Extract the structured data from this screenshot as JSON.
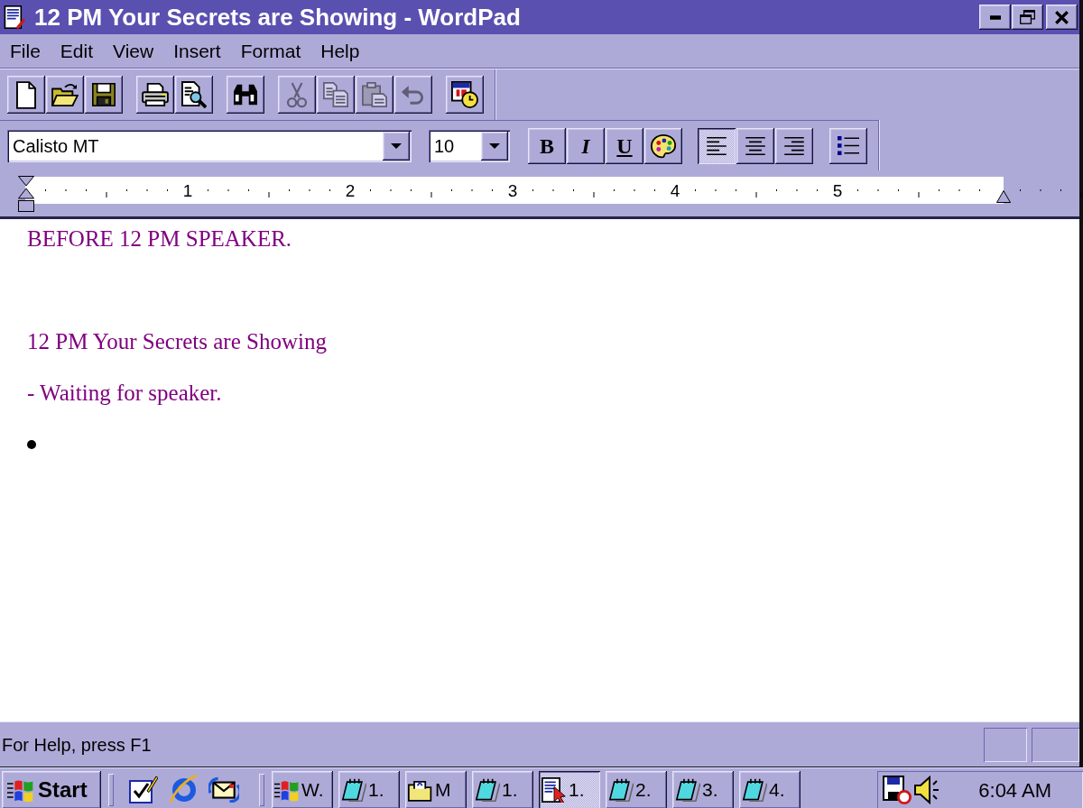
{
  "window": {
    "title": "12 PM Your Secrets are Showing - WordPad"
  },
  "menu_bar": [
    "File",
    "Edit",
    "View",
    "Insert",
    "Format",
    "Help"
  ],
  "toolbar": {
    "groups": [
      [
        {
          "disabled": false
        },
        {
          "disabled": false
        },
        {
          "disabled": false
        }
      ],
      [
        {
          "disabled": false
        },
        {
          "disabled": false
        }
      ],
      [
        {
          "disabled": false
        }
      ],
      [
        {
          "disabled": true
        },
        {
          "disabled": true
        },
        {
          "disabled": true
        },
        {
          "disabled": true
        }
      ],
      [
        {
          "disabled": false
        }
      ]
    ]
  },
  "format_bar": {
    "font": {
      "value": "Calisto MT"
    },
    "size": {
      "value": "10"
    },
    "styles": [
      {
        "label": "B",
        "on": false
      },
      {
        "label": "I",
        "on": false
      },
      {
        "label": "U",
        "on": false
      }
    ],
    "alignment": [
      {
        "selected": true
      },
      {
        "selected": false
      },
      {
        "selected": false
      }
    ],
    "bullets": {
      "on": false
    }
  },
  "ruler": {
    "labels": [
      "1",
      "2",
      "3",
      "4",
      "5"
    ]
  },
  "document": {
    "paragraphs": [
      {
        "kind": "text",
        "text": "BEFORE 12 PM SPEAKER."
      },
      {
        "kind": "blank"
      },
      {
        "kind": "text",
        "text": "12 PM Your Secrets are Showing"
      },
      {
        "kind": "text",
        "text": "- Waiting for speaker."
      },
      {
        "kind": "bullet"
      }
    ]
  },
  "status_bar": {
    "text": "For Help, press F1"
  },
  "taskbar": {
    "start": {
      "label": "Start"
    },
    "tasks": [
      {
        "label": "W.",
        "selected": false
      },
      {
        "label": "1.",
        "selected": false
      },
      {
        "label": "M",
        "selected": false
      },
      {
        "label": "1.",
        "selected": false
      },
      {
        "label": "1.",
        "selected": true
      },
      {
        "label": "2.",
        "selected": false
      },
      {
        "label": "3.",
        "selected": false
      },
      {
        "label": "4.",
        "selected": false
      }
    ],
    "clock": "6:04 AM"
  }
}
